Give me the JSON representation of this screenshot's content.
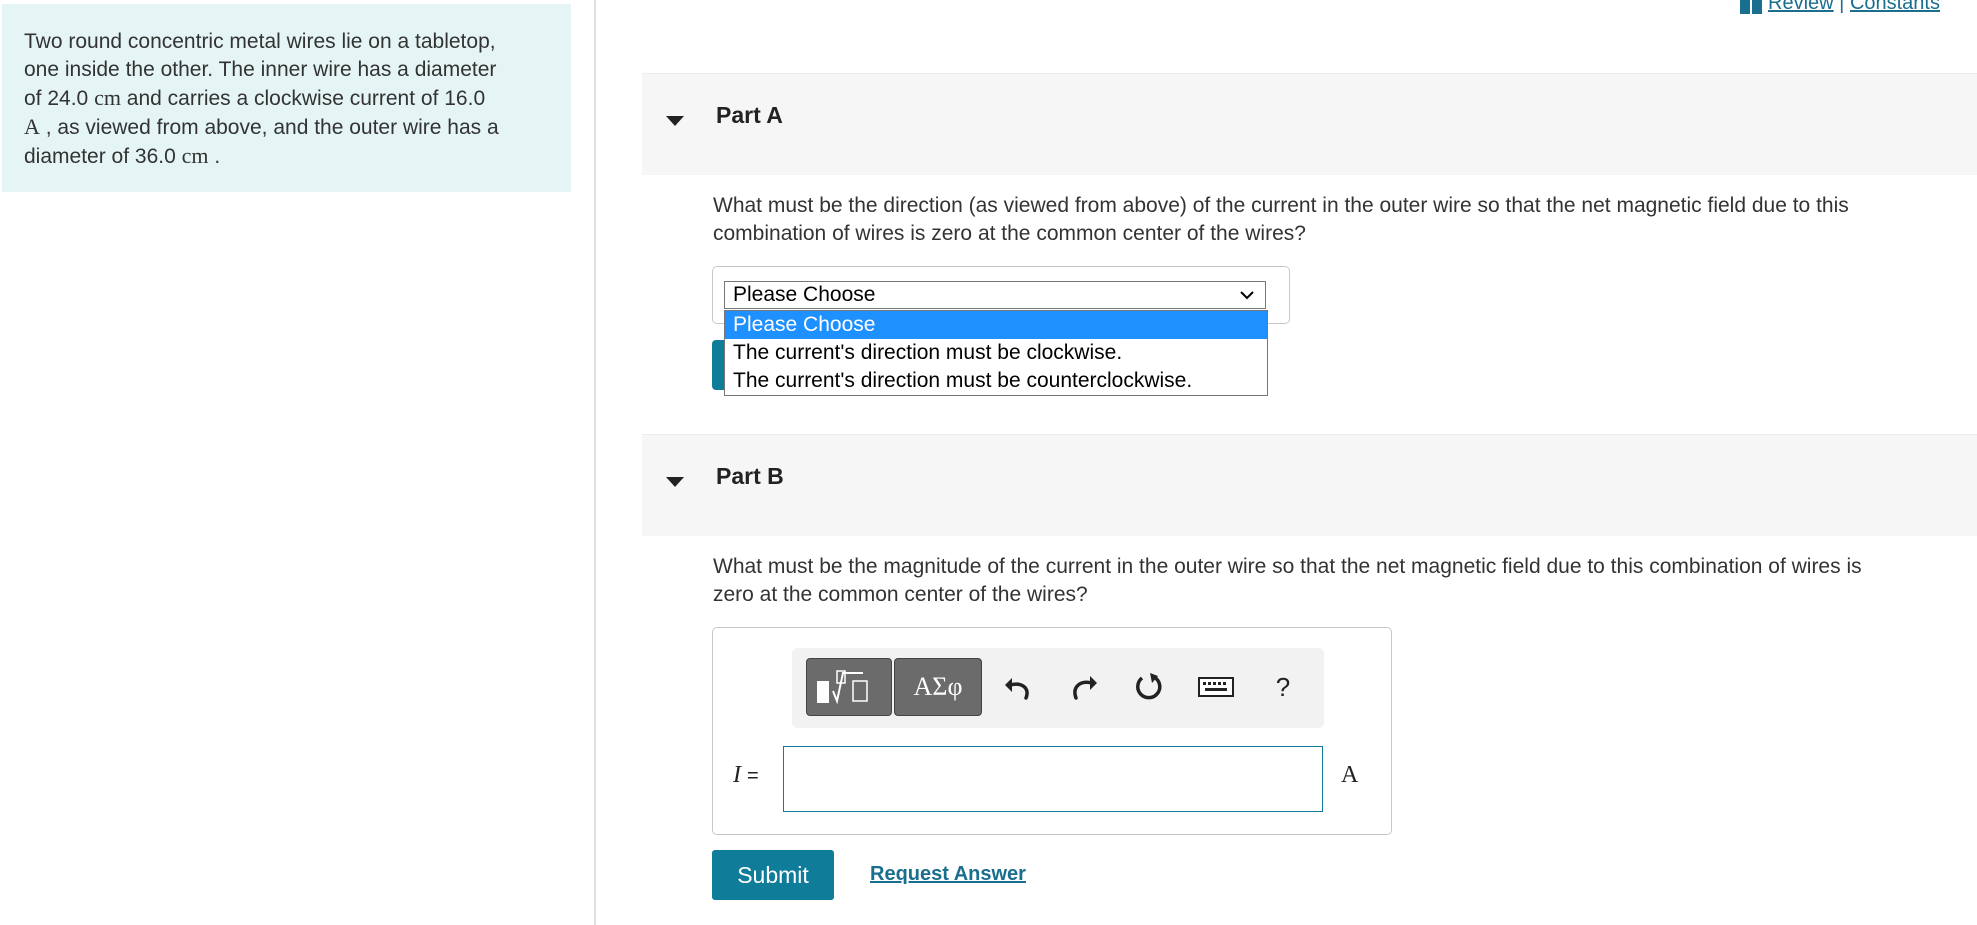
{
  "problem": {
    "line1": "Two round concentric metal wires lie on a tabletop,",
    "line2": "one inside the other. The inner wire has a diameter",
    "line3_pre": "of 24.0 ",
    "inner_diameter_unit": "cm",
    "line3_post": " and carries a clockwise current of 16.0",
    "current_unit": "A",
    "line4_post": " , as viewed from above, and the outer wire has a",
    "line5_pre": "diameter of 36.0 ",
    "outer_diameter_unit": "cm",
    "line5_post": " ."
  },
  "links": {
    "review": "Review",
    "separator": "|",
    "constants": "Constants"
  },
  "part_a": {
    "title": "Part A",
    "question_line1": "What must be the direction (as viewed from above) of the current in the outer wire so that the net magnetic field due to this",
    "question_line2": "combination of wires is zero at the common center of the wires?",
    "select_value": "Please Choose",
    "options": [
      "Please Choose",
      "The current's direction must be clockwise.",
      "The current's direction must be counterclockwise."
    ]
  },
  "part_b": {
    "title": "Part B",
    "question_line1": "What must be the magnitude of the current in the outer wire so that the net magnetic field due to this combination of wires is",
    "question_line2": "zero at the common center of the wires?",
    "greek_label": "ΑΣφ",
    "help_label": "?",
    "variable": "I",
    "equals": "=",
    "unit": "A",
    "input_value": "",
    "submit_label": "Submit",
    "request_label": "Request Answer"
  },
  "colors": {
    "problem_bg": "#e5f5f5",
    "accent": "#0f7c9a",
    "link": "#1a6e8e",
    "selected_option": "#1e90ff"
  },
  "icons": [
    "book-icon",
    "templates-icon",
    "greek-icon",
    "undo-icon",
    "redo-icon",
    "reset-icon",
    "keyboard-icon",
    "help-icon",
    "caret-down-icon",
    "chevron-down-icon"
  ]
}
